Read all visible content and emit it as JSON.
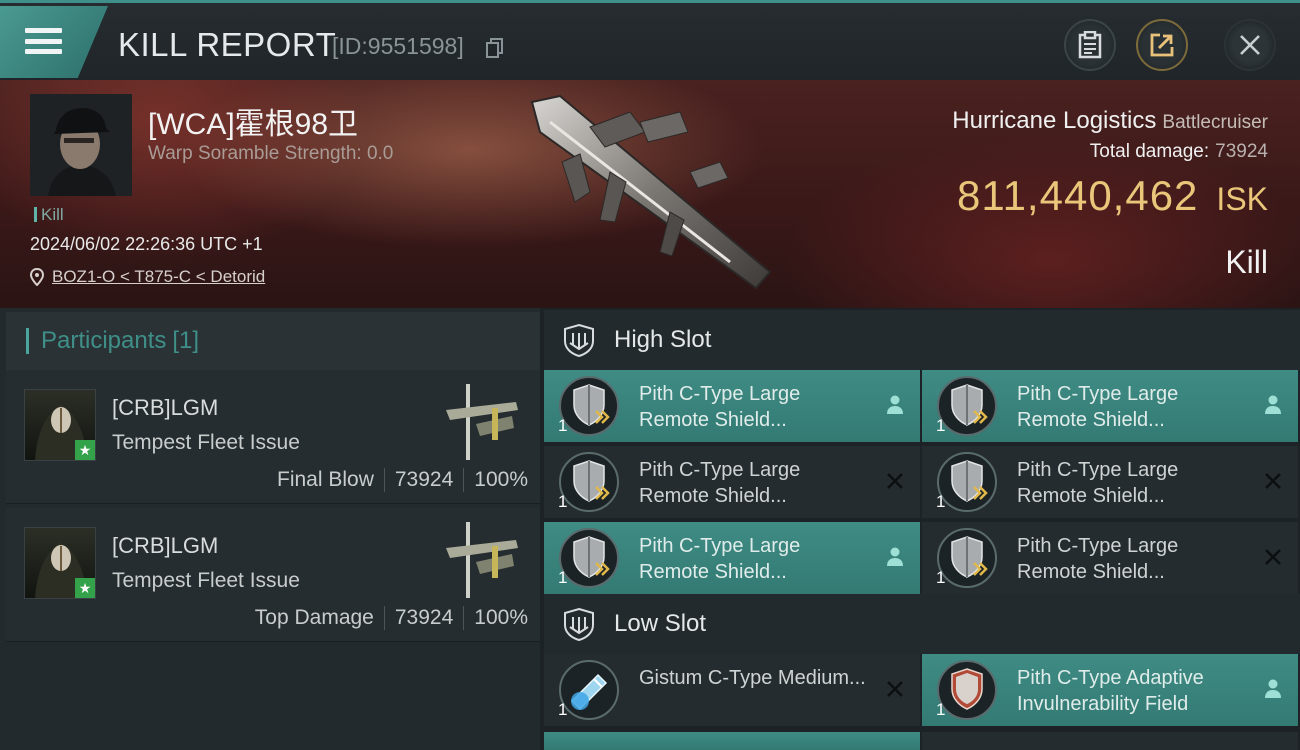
{
  "header": {
    "title": "KILL REPORT",
    "report_id": "[ID:9551598]"
  },
  "victim": {
    "pilot_name": "[WCA]霍根98卫",
    "warp_scramble": "Warp Soramble Strength: 0.0",
    "tag": "Kill",
    "timestamp": "2024/06/02 22:26:36 UTC +1",
    "location": "BOZ1-O < T875-C < Detorid",
    "ship_name": "Hurricane Logistics",
    "ship_class": "Battlecruiser",
    "total_damage_label": "Total damage:",
    "total_damage": "73924",
    "isk_value": "811,440,462",
    "isk_unit": "ISK",
    "result": "Kill"
  },
  "participants": {
    "label": "Participants",
    "count": "[1]",
    "rows": [
      {
        "pilot": "[CRB]LGM",
        "ship": "Tempest Fleet Issue",
        "role": "Final Blow",
        "damage": "73924",
        "percent": "100%"
      },
      {
        "pilot": "[CRB]LGM",
        "ship": "Tempest Fleet Issue",
        "role": "Top Damage",
        "damage": "73924",
        "percent": "100%"
      }
    ]
  },
  "high_slot": {
    "label": "High Slot",
    "modules": [
      {
        "name": "Pith C-Type Large Remote Shield...",
        "qty": "1",
        "state": "fitted",
        "icon": "shield-booster-icon"
      },
      {
        "name": "Pith C-Type Large Remote Shield...",
        "qty": "1",
        "state": "fitted",
        "icon": "shield-booster-icon"
      },
      {
        "name": "Pith C-Type Large Remote Shield...",
        "qty": "1",
        "state": "destroyed",
        "icon": "shield-booster-icon"
      },
      {
        "name": "Pith C-Type Large Remote Shield...",
        "qty": "1",
        "state": "destroyed",
        "icon": "shield-booster-icon"
      },
      {
        "name": "Pith C-Type Large Remote Shield...",
        "qty": "1",
        "state": "fitted",
        "icon": "shield-booster-icon"
      },
      {
        "name": "Pith C-Type Large Remote Shield...",
        "qty": "1",
        "state": "destroyed",
        "icon": "shield-booster-icon"
      }
    ]
  },
  "low_slot": {
    "label": "Low Slot",
    "modules": [
      {
        "name": "Gistum C-Type Medium...",
        "qty": "1",
        "state": "destroyed",
        "icon": "shield-extender-icon"
      },
      {
        "name": "Pith C-Type Adaptive Invulnerability Field",
        "qty": "1",
        "state": "fitted",
        "icon": "invulnerability-field-icon"
      }
    ]
  },
  "colors": {
    "accent": "#3f8c85",
    "isk": "#eac67a",
    "banner": "#3a1818"
  }
}
